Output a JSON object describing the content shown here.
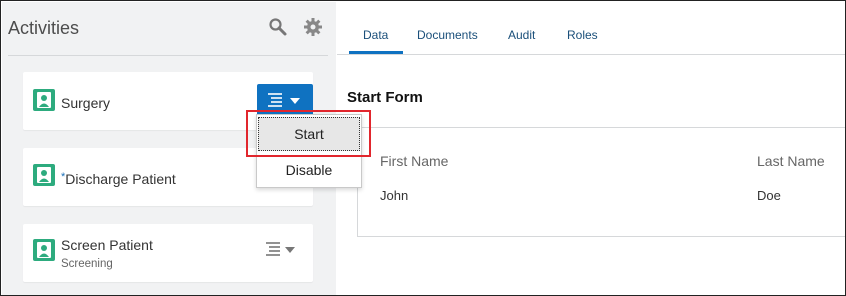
{
  "sidebar": {
    "title": "Activities",
    "icons": [
      "search-icon",
      "gear-icon"
    ],
    "cards": [
      {
        "label": "Surgery",
        "subtitle": "",
        "required": false
      },
      {
        "label": "Discharge Patient",
        "subtitle": "",
        "required": true,
        "required_marker": "*"
      },
      {
        "label": "Screen Patient",
        "subtitle": "Screening",
        "required": false
      }
    ]
  },
  "dropdown": {
    "items": [
      "Start",
      "Disable"
    ],
    "highlighted": "Start"
  },
  "tabs": {
    "items": [
      "Data",
      "Documents",
      "Audit",
      "Roles"
    ],
    "active": "Data"
  },
  "form": {
    "title": "Start Form",
    "columns": [
      "First Name",
      "Last Name"
    ],
    "values": [
      "John",
      "Doe"
    ]
  },
  "colors": {
    "accent": "#0f72c1",
    "activity_icon": "#2dab7e",
    "highlight_border": "#e1262d"
  }
}
